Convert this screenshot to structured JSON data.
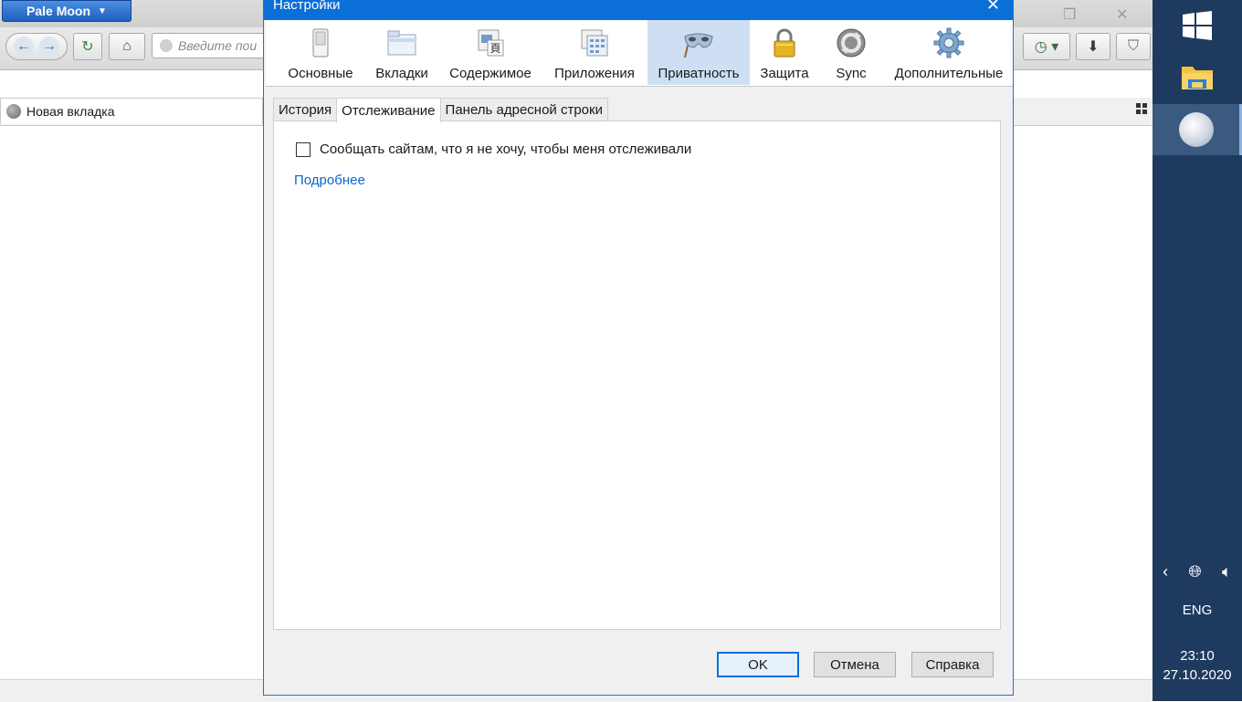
{
  "browser": {
    "app_menu_label": "Pale Moon",
    "url_placeholder": "Введите пои",
    "tab_title": "Новая вкладка"
  },
  "dialog": {
    "title": "Настройки",
    "panes": [
      {
        "label": "Основные",
        "icon": "general-switch-icon"
      },
      {
        "label": "Вкладки",
        "icon": "tabs-icon"
      },
      {
        "label": "Содержимое",
        "icon": "content-icon"
      },
      {
        "label": "Приложения",
        "icon": "applications-icon"
      },
      {
        "label": "Приватность",
        "icon": "privacy-mask-icon",
        "selected": true
      },
      {
        "label": "Защита",
        "icon": "security-lock-icon"
      },
      {
        "label": "Sync",
        "icon": "sync-icon"
      },
      {
        "label": "Дополнительные",
        "icon": "advanced-gear-icon"
      }
    ],
    "subtabs": [
      {
        "label": "История"
      },
      {
        "label": "Отслеживание",
        "selected": true
      },
      {
        "label": "Панель адресной строки"
      }
    ],
    "dnt_checkbox_label": "Сообщать сайтам, что я не хочу, чтобы меня отслеживали",
    "dnt_checked": false,
    "learn_more": "Подробнее",
    "buttons": {
      "ok": "OK",
      "cancel": "Отмена",
      "help": "Справка"
    }
  },
  "taskbar": {
    "language": "ENG",
    "time": "23:10",
    "date": "27.10.2020"
  },
  "colors": {
    "dialog_titlebar": "#0a6fd6",
    "selected_pane": "#cfdff3",
    "taskbar": "#1e3a5f",
    "link": "#0a68c9"
  }
}
